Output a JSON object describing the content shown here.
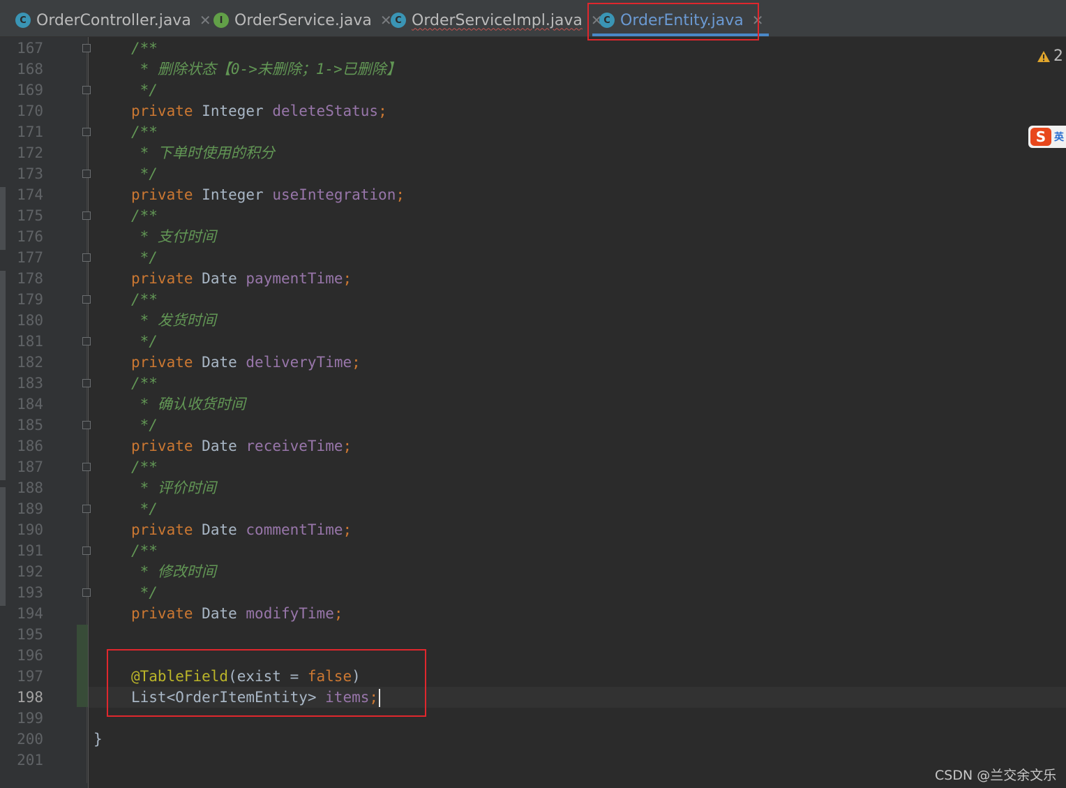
{
  "tabs": [
    {
      "label": "OrderController.java",
      "icon": "C"
    },
    {
      "label": "OrderService.java",
      "icon": "I"
    },
    {
      "label": "OrderServiceImpl.java",
      "icon": "C"
    },
    {
      "label": "OrderEntity.java",
      "icon": "C"
    }
  ],
  "gutter": {
    "line_numbers": [
      "167",
      "168",
      "169",
      "170",
      "171",
      "172",
      "173",
      "174",
      "175",
      "176",
      "177",
      "178",
      "179",
      "180",
      "181",
      "182",
      "183",
      "184",
      "185",
      "186",
      "187",
      "188",
      "189",
      "190",
      "191",
      "192",
      "193",
      "194",
      "195",
      "196",
      "197",
      "198",
      "199",
      "200",
      "201"
    ]
  },
  "code": {
    "l167": "/**",
    "l168": " * 删除状态【0->未删除；1->已删除】",
    "l169": " */",
    "l170": {
      "kw": "private",
      "type": "Integer",
      "name": "deleteStatus"
    },
    "l171": "/**",
    "l172": " * 下单时使用的积分",
    "l173": " */",
    "l174": {
      "kw": "private",
      "type": "Integer",
      "name": "useIntegration"
    },
    "l175": "/**",
    "l176": " * 支付时间",
    "l177": " */",
    "l178": {
      "kw": "private",
      "type": "Date",
      "name": "paymentTime"
    },
    "l179": "/**",
    "l180": " * 发货时间",
    "l181": " */",
    "l182": {
      "kw": "private",
      "type": "Date",
      "name": "deliveryTime"
    },
    "l183": "/**",
    "l184": " * 确认收货时间",
    "l185": " */",
    "l186": {
      "kw": "private",
      "type": "Date",
      "name": "receiveTime"
    },
    "l187": "/**",
    "l188": " * 评价时间",
    "l189": " */",
    "l190": {
      "kw": "private",
      "type": "Date",
      "name": "commentTime"
    },
    "l191": "/**",
    "l192": " * 修改时间",
    "l193": " */",
    "l194": {
      "kw": "private",
      "type": "Date",
      "name": "modifyTime"
    },
    "l197": {
      "annotation": "@TableField",
      "args_open": "(exist = ",
      "value": "false",
      "args_close": ")"
    },
    "l198": {
      "type": "List<OrderItemEntity> ",
      "name": "items",
      "semi": ";"
    },
    "l200": "}"
  },
  "semicolon": ";",
  "warnings": {
    "count": "2"
  },
  "ime": {
    "label": "英"
  },
  "watermark": "CSDN @兰交余文乐"
}
